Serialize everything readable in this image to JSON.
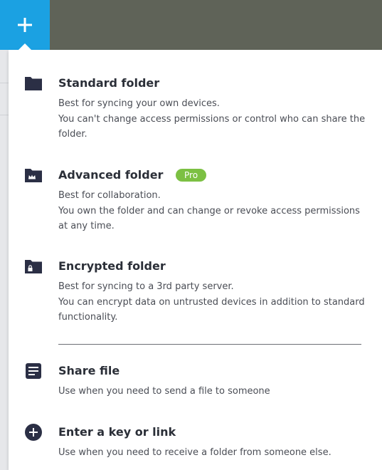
{
  "menu": {
    "items": [
      {
        "title": "Standard folder",
        "description": [
          "Best for syncing your own devices.",
          "You can't change access permissions or control who can share the folder."
        ],
        "icon": "folder-icon"
      },
      {
        "title": "Advanced folder",
        "badge": "Pro",
        "description": [
          "Best for collaboration.",
          "You own the folder and can change or revoke access permissions at any time."
        ],
        "icon": "folder-crown-icon"
      },
      {
        "title": "Encrypted folder",
        "description": [
          "Best for syncing to a 3rd party server.",
          "You can encrypt data on untrusted devices in addition to standard functionality."
        ],
        "icon": "folder-lock-icon"
      },
      {
        "title": "Share file",
        "description": [
          "Use when you need to send a file to someone"
        ],
        "icon": "document-icon"
      },
      {
        "title": "Enter a key or link",
        "description": [
          "Use when you need to receive a folder from someone else."
        ],
        "icon": "plus-circle-icon"
      }
    ]
  },
  "colors": {
    "accent": "#1ba1e2",
    "topbar": "#5f6358",
    "pro_badge": "#7cc043",
    "icon": "#2b2f45"
  },
  "toolbar": {
    "add_icon": "plus-icon"
  }
}
